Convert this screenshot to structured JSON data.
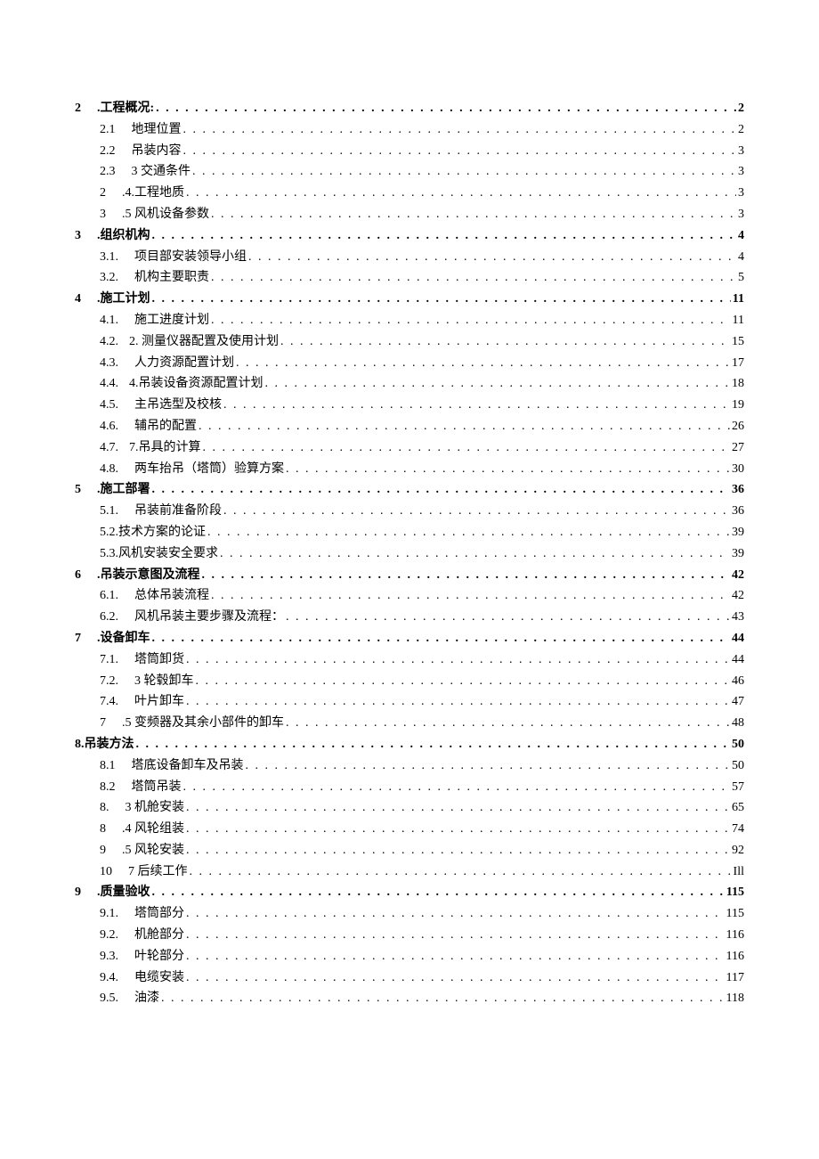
{
  "toc": [
    {
      "level": 1,
      "num": "2",
      "title": ".工程概况:",
      "page": "2"
    },
    {
      "level": 2,
      "num": "2.1",
      "title": "地理位置",
      "page": "2",
      "gap": "med"
    },
    {
      "level": 2,
      "num": "2.2",
      "title": "吊装内容",
      "page": "3",
      "gap": "med"
    },
    {
      "level": 2,
      "num": "2.3",
      "title": "3 交通条件",
      "page": "3",
      "gap": "med"
    },
    {
      "level": 2,
      "num": "2",
      "title": ".4.工程地质",
      "page": "3",
      "gap": "med"
    },
    {
      "level": 2,
      "num": "3",
      "title": ".5 风机设备参数",
      "page": "3",
      "gap": "med"
    },
    {
      "level": 1,
      "num": "3",
      "title": ".组织机构",
      "page": "4"
    },
    {
      "level": 2,
      "num": "3.1.",
      "title": "项目部安装领导小组",
      "page": "4",
      "gap": "med"
    },
    {
      "level": 2,
      "num": "3.2.",
      "title": "机构主要职责",
      "page": "5",
      "gap": "med"
    },
    {
      "level": 1,
      "num": "4",
      "title": ".施工计划",
      "page": "11"
    },
    {
      "level": 2,
      "num": "4.1.",
      "title": "施工进度计划",
      "page": "11",
      "gap": "med"
    },
    {
      "level": 2,
      "num": "4.2.",
      "title": "2. 测量仪器配置及使用计划",
      "page": "15",
      "gap": "small"
    },
    {
      "level": 2,
      "num": "4.3.",
      "title": "人力资源配置计划",
      "page": "17",
      "gap": "med"
    },
    {
      "level": 2,
      "num": "4.4.",
      "title": "4.吊装设备资源配置计划",
      "page": "18",
      "gap": "small"
    },
    {
      "level": 2,
      "num": "4.5.",
      "title": "主吊选型及校核",
      "page": "19",
      "gap": "med"
    },
    {
      "level": 2,
      "num": "4.6.",
      "title": "辅吊的配置",
      "page": "26",
      "gap": "med"
    },
    {
      "level": 2,
      "num": "4.7.",
      "title": "7.吊具的计算",
      "page": "27",
      "gap": "small"
    },
    {
      "level": 2,
      "num": "4.8.",
      "title": "两车抬吊（塔筒）验算方案",
      "page": "30",
      "gap": "med"
    },
    {
      "level": 1,
      "num": "5",
      "title": ".施工部署",
      "page": "36"
    },
    {
      "level": 2,
      "num": "5.1.",
      "title": "吊装前准备阶段",
      "page": "36",
      "gap": "med"
    },
    {
      "level": 2,
      "num": "5.2.",
      "title": "技术方案的论证",
      "page": "39",
      "gap": "none"
    },
    {
      "level": 2,
      "num": "5.3.",
      "title": "风机安装安全要求",
      "page": "39",
      "gap": "none"
    },
    {
      "level": 1,
      "num": "6",
      "title": ".吊装示意图及流程",
      "page": "42"
    },
    {
      "level": 2,
      "num": "6.1.",
      "title": "总体吊装流程",
      "page": "42",
      "gap": "med"
    },
    {
      "level": 2,
      "num": "6.2.",
      "title": "风机吊装主要步骤及流程：",
      "page": "43",
      "gap": "med"
    },
    {
      "level": 1,
      "num": "7",
      "title": ".设备卸车",
      "page": "44"
    },
    {
      "level": 2,
      "num": "7.1.",
      "title": "塔筒卸货",
      "page": "44",
      "gap": "med"
    },
    {
      "level": 2,
      "num": "7.2.",
      "title": "3 轮毂卸车",
      "page": "46",
      "gap": "med"
    },
    {
      "level": 2,
      "num": "7.4.",
      "title": "叶片卸车",
      "page": "47",
      "gap": "med"
    },
    {
      "level": 2,
      "num": "7",
      "title": ".5 变频器及其余小部件的卸车",
      "page": "48",
      "gap": "med"
    },
    {
      "level": 1,
      "num": "8.",
      "title": "吊装方法",
      "page": "50",
      "nogap": true
    },
    {
      "level": 2,
      "num": "8.1",
      "title": "塔底设备卸车及吊装",
      "page": "50",
      "gap": "med"
    },
    {
      "level": 2,
      "num": "8.2",
      "title": "塔筒吊装",
      "page": "57",
      "gap": "med"
    },
    {
      "level": 2,
      "num": "8.",
      "title": "3 机舱安装",
      "page": "65",
      "gap": "med"
    },
    {
      "level": 2,
      "num": "8",
      "title": ".4 风轮组装",
      "page": "74",
      "gap": "med"
    },
    {
      "level": 2,
      "num": "9",
      "title": ".5 风轮安装",
      "page": "92",
      "gap": "med"
    },
    {
      "level": 2,
      "num": "10",
      "title": "7 后续工作",
      "page": "Ill",
      "gap": "med"
    },
    {
      "level": 1,
      "num": "9",
      "title": ".质量验收",
      "page": "115"
    },
    {
      "level": 2,
      "num": "9.1.",
      "title": "塔筒部分",
      "page": "115",
      "gap": "med"
    },
    {
      "level": 2,
      "num": "9.2.",
      "title": "机舱部分",
      "page": "116",
      "gap": "med"
    },
    {
      "level": 2,
      "num": "9.3.",
      "title": "叶轮部分",
      "page": "116",
      "gap": "med"
    },
    {
      "level": 2,
      "num": "9.4.",
      "title": "电缆安装",
      "page": "117",
      "gap": "med"
    },
    {
      "level": 2,
      "num": "9.5.",
      "title": "油漆",
      "page": "118",
      "gap": "med"
    }
  ]
}
